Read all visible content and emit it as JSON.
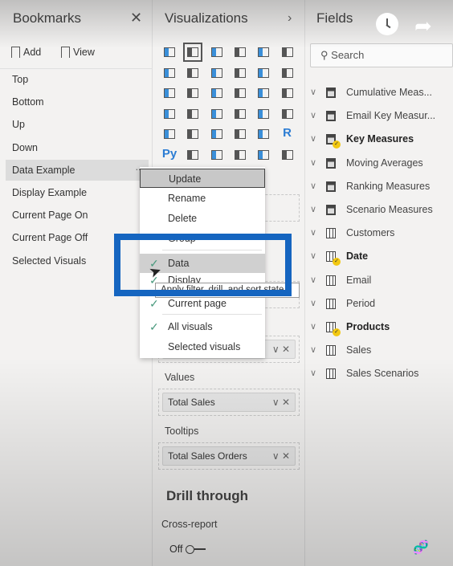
{
  "bookmarks": {
    "title": "Bookmarks",
    "add_label": "Add",
    "view_label": "View",
    "items": [
      "Top",
      "Bottom",
      "Up",
      "Down",
      "Data Example",
      "Display Example",
      "Current Page On",
      "Current Page Off",
      "Selected Visuals"
    ],
    "selected": "Data Example",
    "more_label": "..."
  },
  "visualizations": {
    "title": "Visualizations",
    "icons": [
      "stacked-bar",
      "stacked-column",
      "clustered-bar",
      "clustered-column",
      "100-bar",
      "100-column",
      "line",
      "area",
      "stacked-area",
      "line-column",
      "line-clustered-column",
      "ribbon",
      "waterfall",
      "funnel",
      "scatter",
      "pie",
      "donut",
      "treemap",
      "map",
      "filled-map",
      "shape-map",
      "azure-map",
      "gauge",
      "card",
      "multirow-card",
      "kpi",
      "slicer",
      "table",
      "matrix",
      "r-visual",
      "python-visual",
      "key-influencers",
      "decomposition-tree",
      "qa",
      "paginated-report",
      "power-apps"
    ],
    "r_label": "R",
    "py_label": "Py",
    "wells": [
      {
        "label": "Values",
        "value": "Total Sales"
      },
      {
        "label": "Tooltips",
        "value": "Total Sales Orders"
      }
    ],
    "drill_through": "Drill through",
    "cross_report": "Cross-report",
    "toggle_label": "Off"
  },
  "context_menu": {
    "items": [
      {
        "label": "Update",
        "checked": false
      },
      {
        "label": "Rename",
        "checked": false
      },
      {
        "label": "Delete",
        "checked": false
      },
      {
        "label": "Group",
        "checked": false
      },
      {
        "label": "Data",
        "checked": true
      },
      {
        "label": "Display",
        "checked": true
      },
      {
        "label": "Current page",
        "checked": true
      },
      {
        "label": "All visuals",
        "checked": true
      },
      {
        "label": "Selected visuals",
        "checked": false
      }
    ],
    "tooltip": "Apply filter, drill, and sort state",
    "highlight_color": "#1565c0"
  },
  "fields": {
    "title": "Fields",
    "search_placeholder": "Search",
    "items": [
      {
        "label": "Cumulative Meas...",
        "type": "measure",
        "bold": false
      },
      {
        "label": "Email Key Measur...",
        "type": "measure",
        "bold": false
      },
      {
        "label": "Key Measures",
        "type": "measure",
        "bold": true
      },
      {
        "label": "Moving Averages",
        "type": "measure",
        "bold": false
      },
      {
        "label": "Ranking Measures",
        "type": "measure",
        "bold": false
      },
      {
        "label": "Scenario Measures",
        "type": "measure",
        "bold": false
      },
      {
        "label": "Customers",
        "type": "table",
        "bold": false
      },
      {
        "label": "Date",
        "type": "table",
        "bold": true
      },
      {
        "label": "Email",
        "type": "table",
        "bold": false
      },
      {
        "label": "Period",
        "type": "table",
        "bold": false
      },
      {
        "label": "Products",
        "type": "table",
        "bold": true
      },
      {
        "label": "Sales",
        "type": "table",
        "bold": false
      },
      {
        "label": "Sales Scenarios",
        "type": "table",
        "bold": false
      }
    ]
  },
  "video_overlay": {
    "icons": [
      "clock-icon",
      "share-icon"
    ]
  }
}
